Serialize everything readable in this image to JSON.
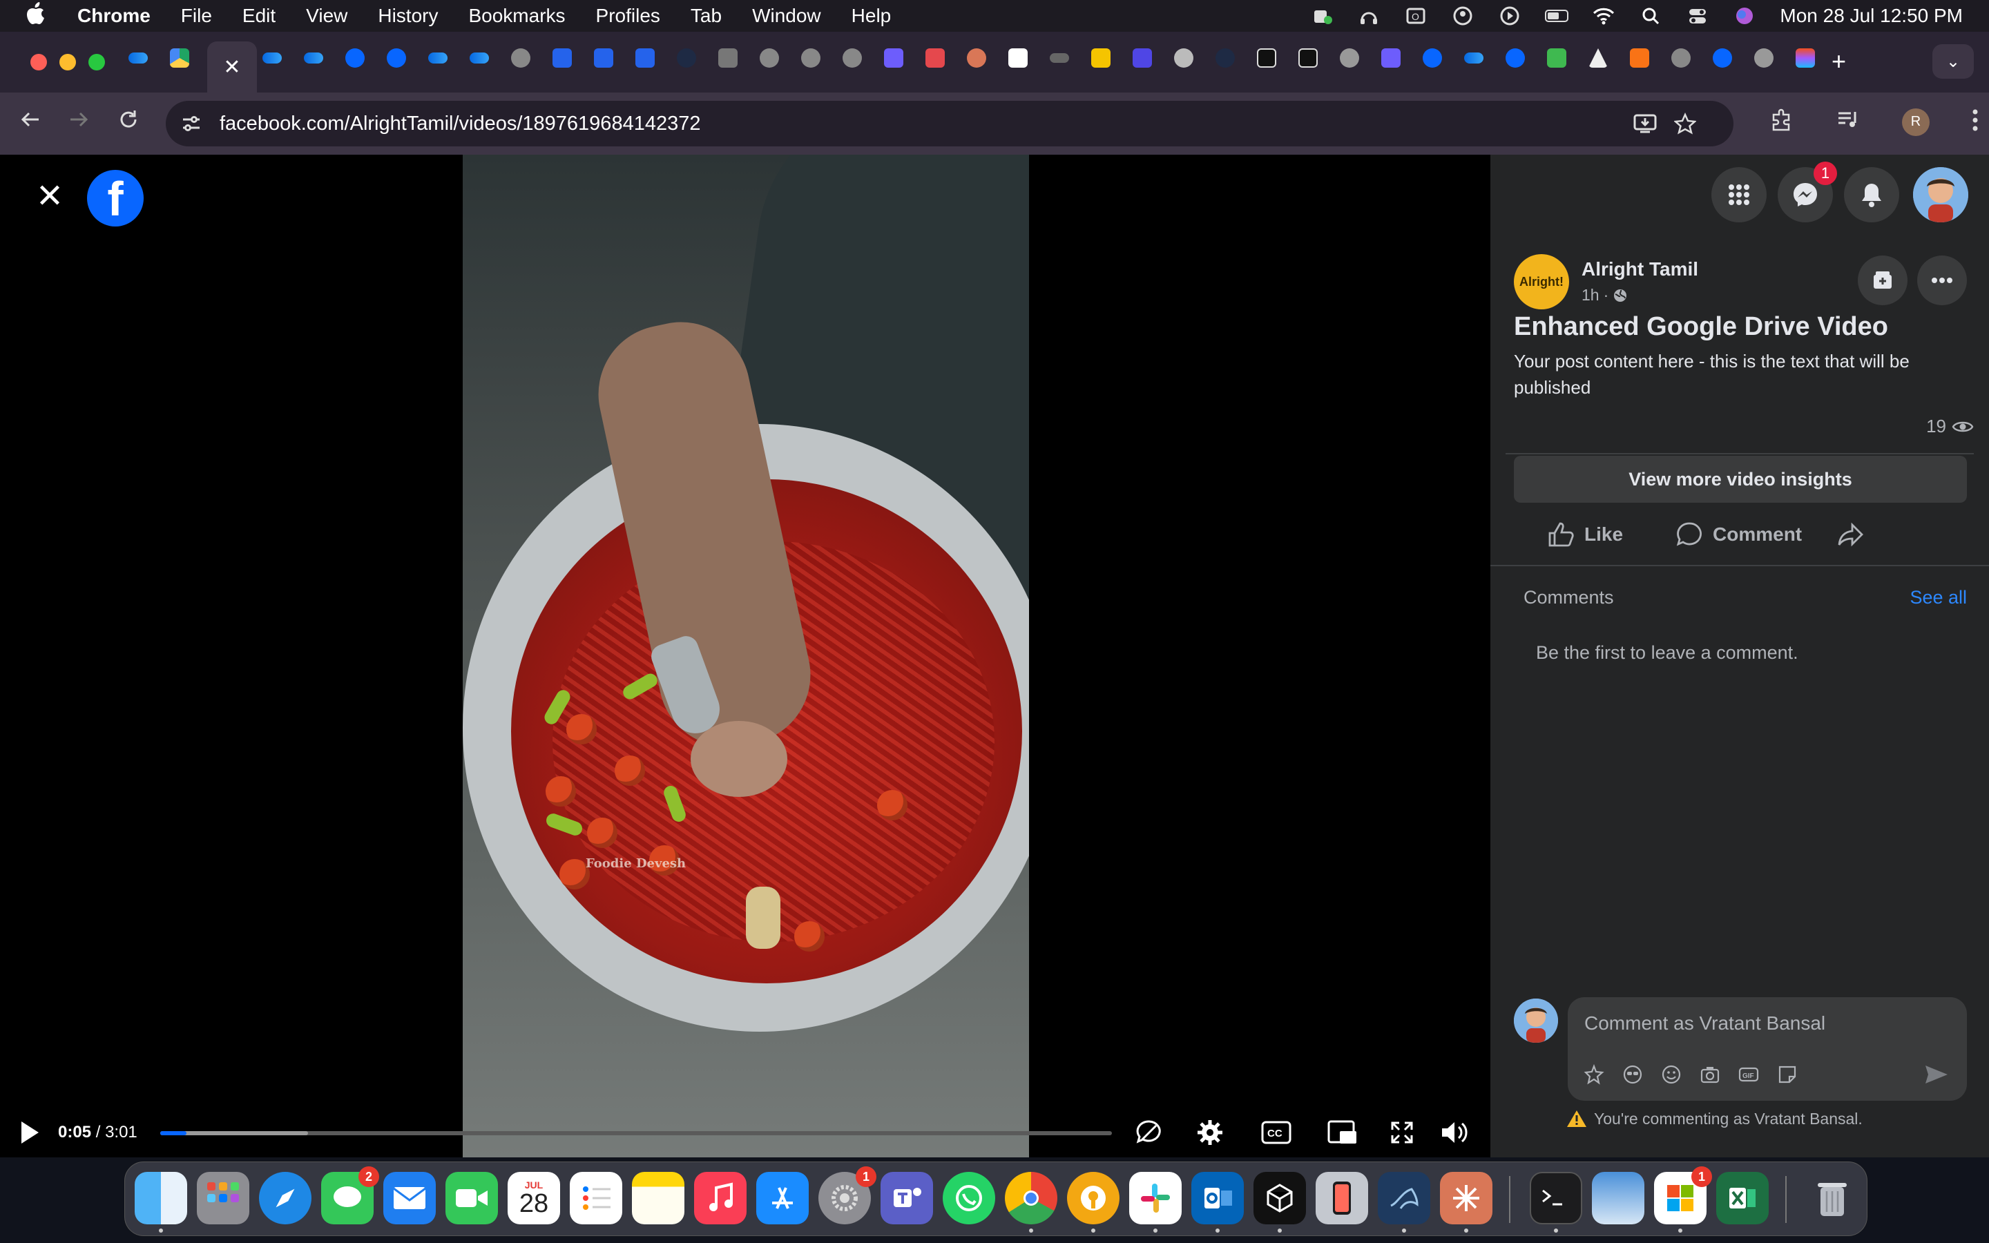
{
  "menubar": {
    "app_name": "Chrome",
    "items": [
      "File",
      "Edit",
      "View",
      "History",
      "Bookmarks",
      "Profiles",
      "Tab",
      "Window",
      "Help"
    ],
    "datetime": "Mon 28 Jul  12:50 PM"
  },
  "tabs": {
    "active_close": "✕",
    "new_tab": "+",
    "menu": "⌄"
  },
  "toolbar": {
    "url": "facebook.com/AlrightTamil/videos/1897619684142372",
    "profile_initial": "R"
  },
  "viewer": {
    "close": "✕",
    "logo": "f",
    "watermark": "Foodie Devesh",
    "current_time": "0:05",
    "duration": "3:01",
    "progress_fraction": 0.0276,
    "buffered_fraction": 0.155
  },
  "panel": {
    "messenger_badge": "1",
    "page_name": "Alright Tamil",
    "page_avatar_text": "Alright!",
    "post_age": "1h",
    "post_title": "Enhanced Google Drive Video",
    "post_body": "Your post content here - this is the text that will be published",
    "view_count": "19",
    "insights_button": "View more video insights",
    "like_label": "Like",
    "comment_label": "Comment",
    "comments_header": "Comments",
    "see_all": "See all",
    "empty_comments": "Be the first to leave a comment.",
    "comment_placeholder": "Comment as Vratant Bansal",
    "commenting_as": "You're commenting as Vratant Bansal."
  },
  "dock": {
    "messages_badge": "2",
    "settings_badge": "1",
    "office_badge": "1",
    "calendar_month": "JUL",
    "calendar_day": "28"
  },
  "colors": {
    "fb_blue": "#0866ff",
    "panel_bg": "#242526",
    "link": "#2d88ff",
    "badge_red": "#e41e3f"
  }
}
